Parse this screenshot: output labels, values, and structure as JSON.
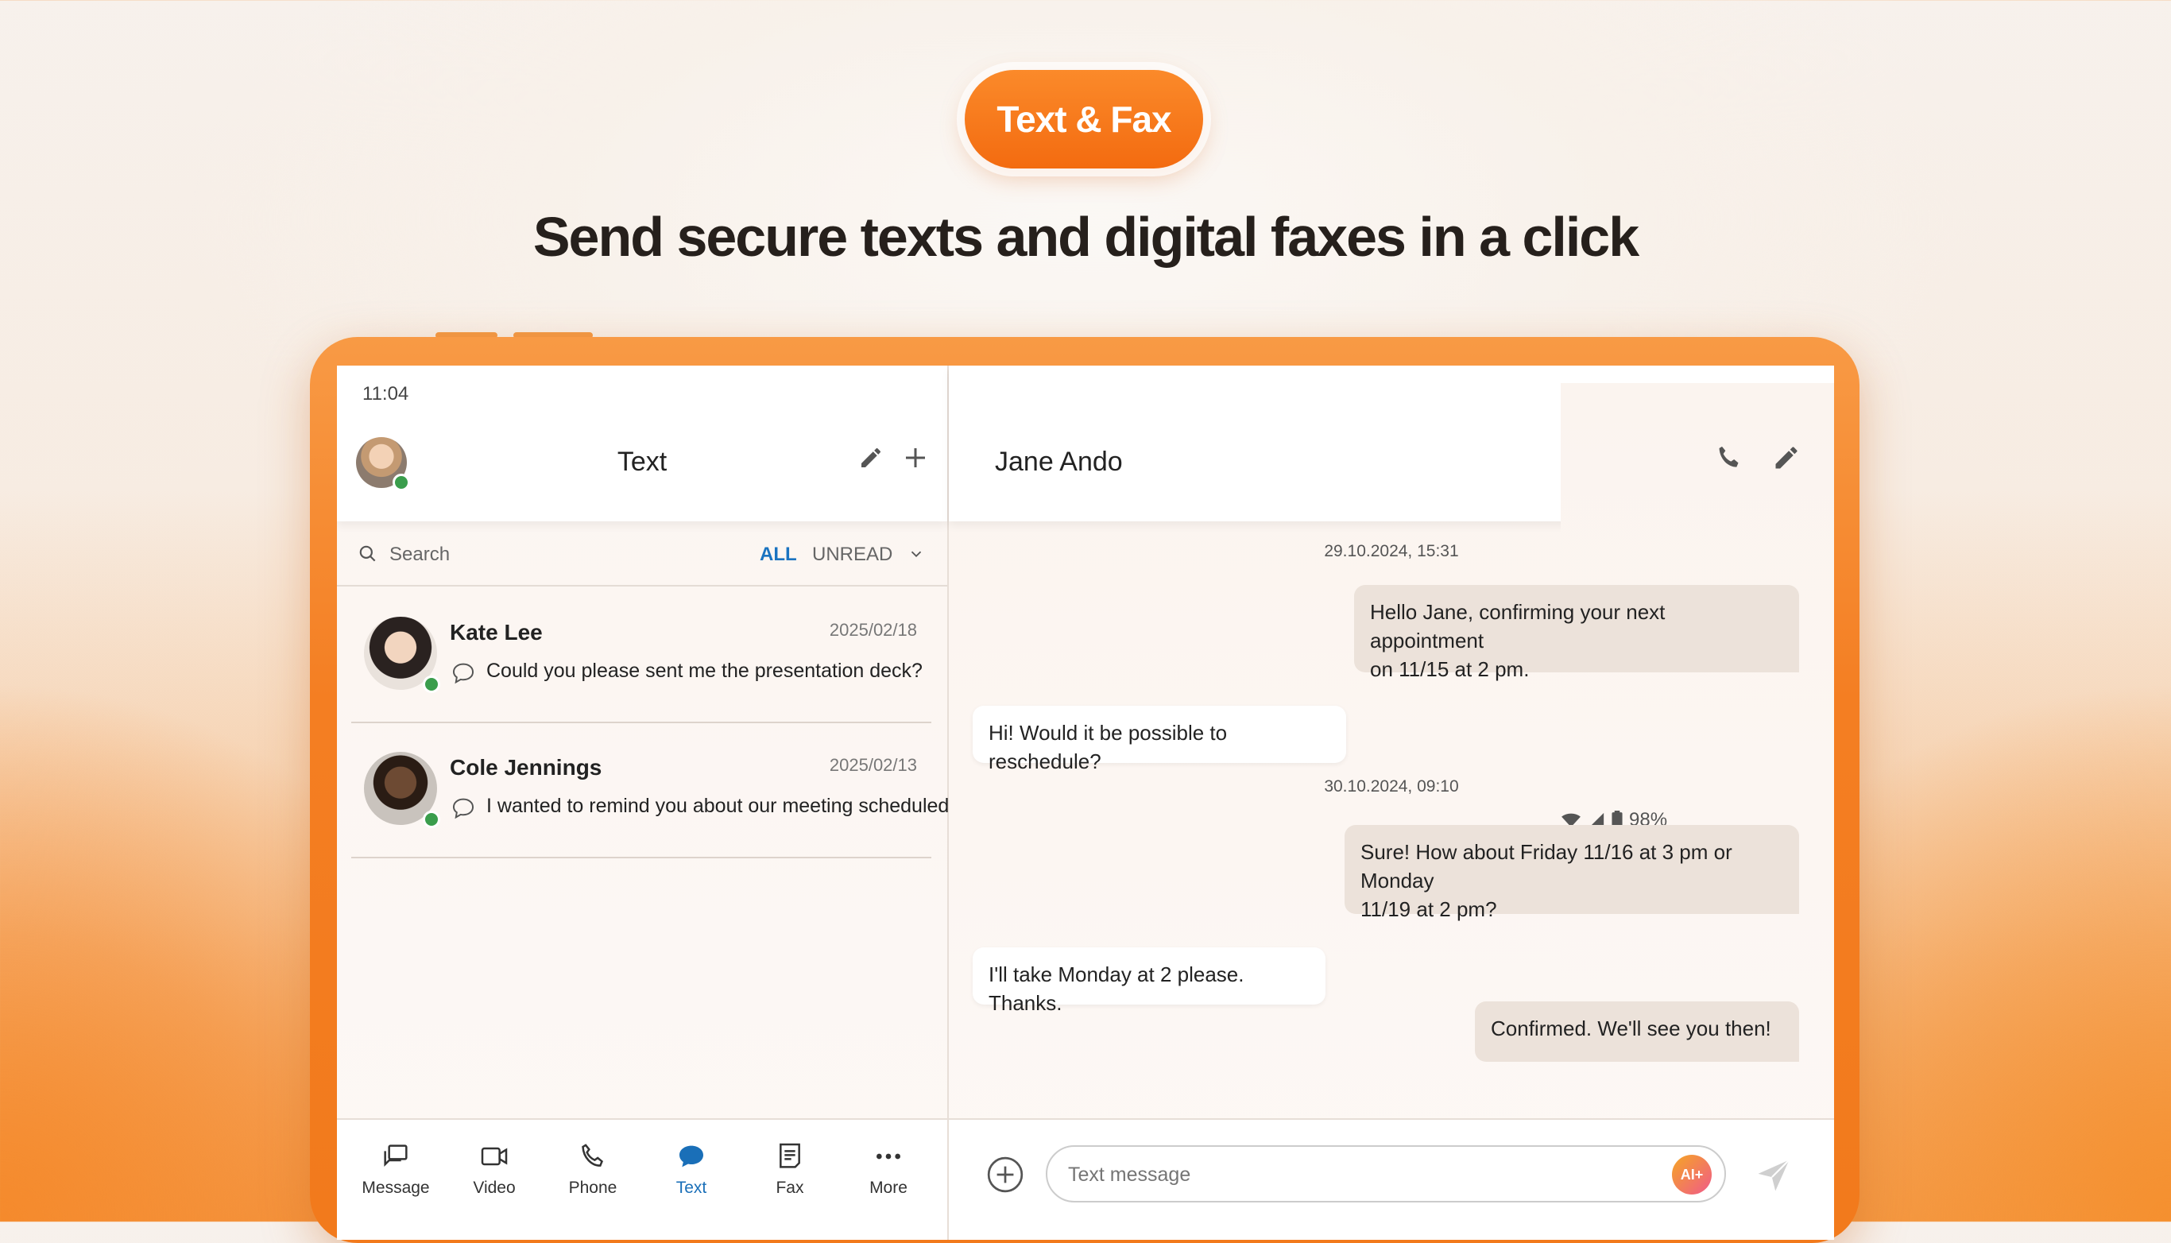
{
  "hero": {
    "badge": "Text & Fax",
    "headline": "Send secure texts and digital faxes in a click"
  },
  "status_bar": {
    "time": "11:04",
    "battery": "98%"
  },
  "left_pane": {
    "title": "Text",
    "search_placeholder": "Search",
    "filter_all": "ALL",
    "filter_unread": "UNREAD",
    "conversations": [
      {
        "name": "Kate Lee",
        "date": "2025/02/18",
        "preview": "Could you please sent me the presentation deck?"
      },
      {
        "name": "Cole Jennings",
        "date": "2025/02/13",
        "preview": "I wanted to remind you about our meeting scheduled..."
      }
    ],
    "nav": [
      {
        "label": "Message",
        "icon": "message-icon"
      },
      {
        "label": "Video",
        "icon": "video-icon"
      },
      {
        "label": "Phone",
        "icon": "phone-icon"
      },
      {
        "label": "Text",
        "icon": "text-bubble-icon",
        "active": true
      },
      {
        "label": "Fax",
        "icon": "fax-icon"
      },
      {
        "label": "More",
        "icon": "more-icon"
      }
    ]
  },
  "right_pane": {
    "contact_name": "Jane Ando",
    "timestamps": [
      "29.10.2024, 15:31",
      "30.10.2024, 09:10"
    ],
    "messages": [
      {
        "direction": "out",
        "text_line1": "Hello Jane, confirming your next appointment",
        "text_line2": "on 11/15 at 2 pm."
      },
      {
        "direction": "in",
        "text": "Hi! Would it be possible to reschedule?"
      },
      {
        "direction": "out",
        "text_line1": "Sure! How about Friday 11/16 at 3 pm or Monday",
        "text_line2": "11/19 at 2 pm?"
      },
      {
        "direction": "in",
        "text": "I'll take Monday at 2 please. Thanks."
      },
      {
        "direction": "out",
        "text": "Confirmed. We'll see you then!"
      }
    ],
    "composer": {
      "placeholder": "Text message",
      "ai_badge": "AI+"
    }
  },
  "colors": {
    "accent_orange": "#f47e22",
    "active_blue": "#1a6fb8",
    "online_green": "#3a9d4c",
    "outgoing_bubble": "#ece2da"
  }
}
